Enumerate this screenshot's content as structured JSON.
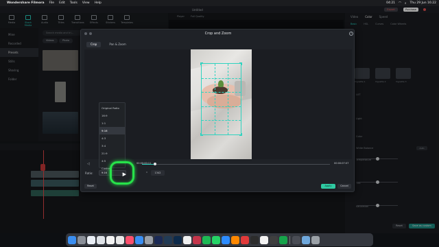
{
  "menubar": {
    "app_name": "Wondershare Filmora",
    "items": [
      "File",
      "Edit",
      "Tools",
      "View",
      "Help"
    ],
    "clock": "Thu 29 Jun 16:22",
    "cpu": "04:21"
  },
  "app": {
    "window_title": "Untitled",
    "export_label": "Export",
    "purchase_label": "Purchase",
    "toolbar": [
      "Media",
      "Stock Media",
      "Audio",
      "Titles",
      "Transitions",
      "Effects",
      "Stickers",
      "Templates"
    ],
    "leftnav": [
      "Mine",
      "Recorded",
      "Presets",
      "Stills",
      "Sharing",
      "Folder"
    ],
    "search_placeholder": "Search media and tri...",
    "chips": [
      "Videos",
      "Photo"
    ],
    "preview_labels": [
      "Player",
      "Full Quality"
    ],
    "right_tabs": [
      "Video",
      "Color",
      "Speed"
    ],
    "right_subtabs": [
      "Basic",
      "HSL",
      "Curves",
      "Color Wheels"
    ],
    "presets": [
      "Vignette 1",
      "Vignette 2",
      "Vignette 3"
    ],
    "right_rows": [
      "LUT",
      "Light",
      "Color",
      "White Balance",
      "Temperature",
      "Tint",
      "Saturation"
    ],
    "auto_label": "Auto",
    "reset_label": "Reset",
    "save_preset_label": "Save as custom"
  },
  "dialog": {
    "title": "Crop and Zoom",
    "tabs": [
      "Crop",
      "Pan & Zoom"
    ],
    "current_time": "00:00:00:11",
    "end_time": "00:00:07:07",
    "playback_fraction": 0.07,
    "ratio_label": "Ratio:",
    "ratio_value": "9:16",
    "width_value": "1012",
    "x_sign": "x",
    "height_value": "1342",
    "reset_label": "Reset",
    "apply_label": "Apply",
    "cancel_label": "Cancel",
    "ratio_options": [
      "Original Ratio",
      "16:9",
      "1:1",
      "9:16",
      "4:3",
      "3:4",
      "21:9",
      "4:5",
      "Custom"
    ],
    "selected_option": "9:16"
  },
  "colors": {
    "accent": "#2ed3bf",
    "apply": "#2fcaa2",
    "highlight": "#27e24a",
    "playhead": "#e54848"
  }
}
